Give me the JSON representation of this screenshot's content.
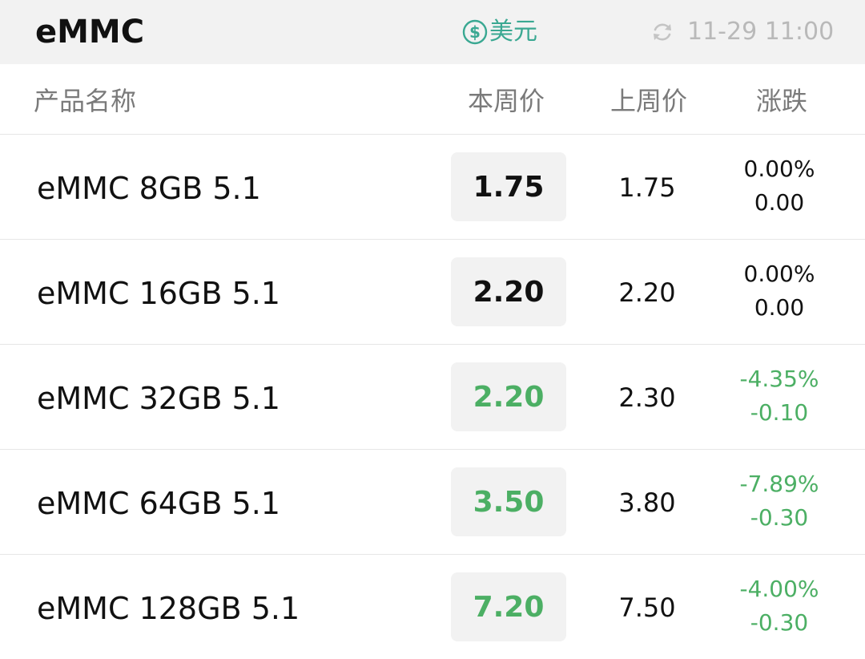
{
  "header": {
    "title": "eMMC",
    "currency_label": "美元",
    "currency_icon": "dollar-circle-icon",
    "refresh_icon": "refresh-icon",
    "updated_time": "11-29 11:00",
    "accent_color": "#3aa892"
  },
  "columns": {
    "name": "产品名称",
    "this_week": "本周价",
    "last_week": "上周价",
    "change": "涨跌"
  },
  "rows": [
    {
      "name": "eMMC 8GB 5.1",
      "this_week": "1.75",
      "last_week": "1.75",
      "change_pct": "0.00%",
      "change_abs": "0.00",
      "trend": "flat"
    },
    {
      "name": "eMMC 16GB 5.1",
      "this_week": "2.20",
      "last_week": "2.20",
      "change_pct": "0.00%",
      "change_abs": "0.00",
      "trend": "flat"
    },
    {
      "name": "eMMC 32GB 5.1",
      "this_week": "2.20",
      "last_week": "2.30",
      "change_pct": "-4.35%",
      "change_abs": "-0.10",
      "trend": "down"
    },
    {
      "name": "eMMC 64GB 5.1",
      "this_week": "3.50",
      "last_week": "3.80",
      "change_pct": "-7.89%",
      "change_abs": "-0.30",
      "trend": "down"
    },
    {
      "name": "eMMC 128GB 5.1",
      "this_week": "7.20",
      "last_week": "7.50",
      "change_pct": "-4.00%",
      "change_abs": "-0.30",
      "trend": "down"
    }
  ],
  "colors": {
    "down": "#4caf64",
    "flat": "#111111"
  }
}
